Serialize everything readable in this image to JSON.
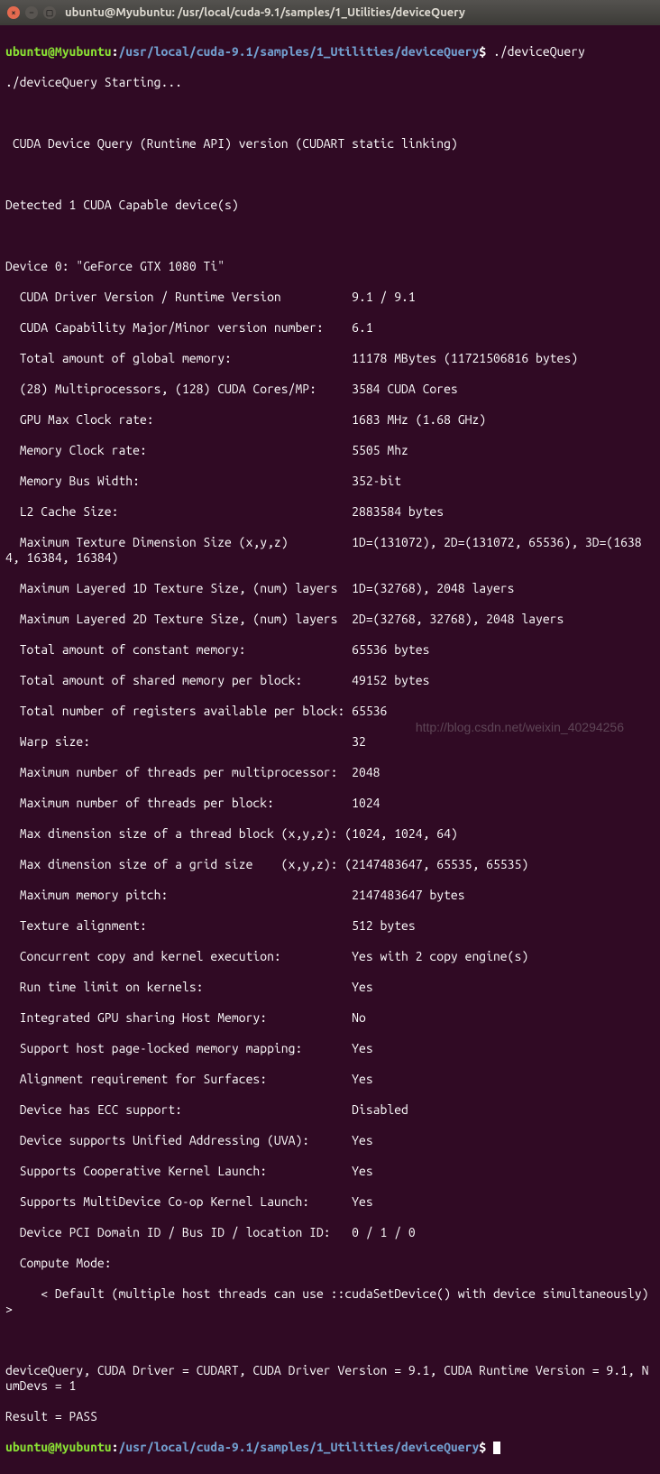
{
  "window": {
    "title": "ubuntu@Myubuntu: /usr/local/cuda-9.1/samples/1_Utilities/deviceQuery"
  },
  "prompt": {
    "user_host": "ubuntu@Myubuntu",
    "sep1": ":",
    "path": "/usr/local/cuda-9.1/samples/1_Utilities/deviceQuery",
    "sigil": "$"
  },
  "cmd": " ./deviceQuery",
  "lines": {
    "l0": "./deviceQuery Starting...",
    "l1": " CUDA Device Query (Runtime API) version (CUDART static linking)",
    "l2": "Detected 1 CUDA Capable device(s)",
    "l3": "Device 0: \"GeForce GTX 1080 Ti\"",
    "l4": "  CUDA Driver Version / Runtime Version          9.1 / 9.1",
    "l5": "  CUDA Capability Major/Minor version number:    6.1",
    "l6": "  Total amount of global memory:                 11178 MBytes (11721506816 bytes)",
    "l7": "  (28) Multiprocessors, (128) CUDA Cores/MP:     3584 CUDA Cores",
    "l8": "  GPU Max Clock rate:                            1683 MHz (1.68 GHz)",
    "l9": "  Memory Clock rate:                             5505 Mhz",
    "l10": "  Memory Bus Width:                              352-bit",
    "l11": "  L2 Cache Size:                                 2883584 bytes",
    "l12": "  Maximum Texture Dimension Size (x,y,z)         1D=(131072), 2D=(131072, 65536), 3D=(16384, 16384, 16384)",
    "l13": "  Maximum Layered 1D Texture Size, (num) layers  1D=(32768), 2048 layers",
    "l14": "  Maximum Layered 2D Texture Size, (num) layers  2D=(32768, 32768), 2048 layers",
    "l15": "  Total amount of constant memory:               65536 bytes",
    "l16": "  Total amount of shared memory per block:       49152 bytes",
    "l17": "  Total number of registers available per block: 65536",
    "l18": "  Warp size:                                     32",
    "l19": "  Maximum number of threads per multiprocessor:  2048",
    "l20": "  Maximum number of threads per block:           1024",
    "l21": "  Max dimension size of a thread block (x,y,z): (1024, 1024, 64)",
    "l22": "  Max dimension size of a grid size    (x,y,z): (2147483647, 65535, 65535)",
    "l23": "  Maximum memory pitch:                          2147483647 bytes",
    "l24": "  Texture alignment:                             512 bytes",
    "l25": "  Concurrent copy and kernel execution:          Yes with 2 copy engine(s)",
    "l26": "  Run time limit on kernels:                     Yes",
    "l27": "  Integrated GPU sharing Host Memory:            No",
    "l28": "  Support host page-locked memory mapping:       Yes",
    "l29": "  Alignment requirement for Surfaces:            Yes",
    "l30": "  Device has ECC support:                        Disabled",
    "l31": "  Device supports Unified Addressing (UVA):      Yes",
    "l32": "  Supports Cooperative Kernel Launch:            Yes",
    "l33": "  Supports MultiDevice Co-op Kernel Launch:      Yes",
    "l34": "  Device PCI Domain ID / Bus ID / location ID:   0 / 1 / 0",
    "l35": "  Compute Mode:",
    "l36": "     < Default (multiple host threads can use ::cudaSetDevice() with device simultaneously) >",
    "l37": "deviceQuery, CUDA Driver = CUDART, CUDA Driver Version = 9.1, CUDA Runtime Version = 9.1, NumDevs = 1",
    "l38": "Result = PASS"
  },
  "watermark": "http://blog.csdn.net/weixin_40294256"
}
